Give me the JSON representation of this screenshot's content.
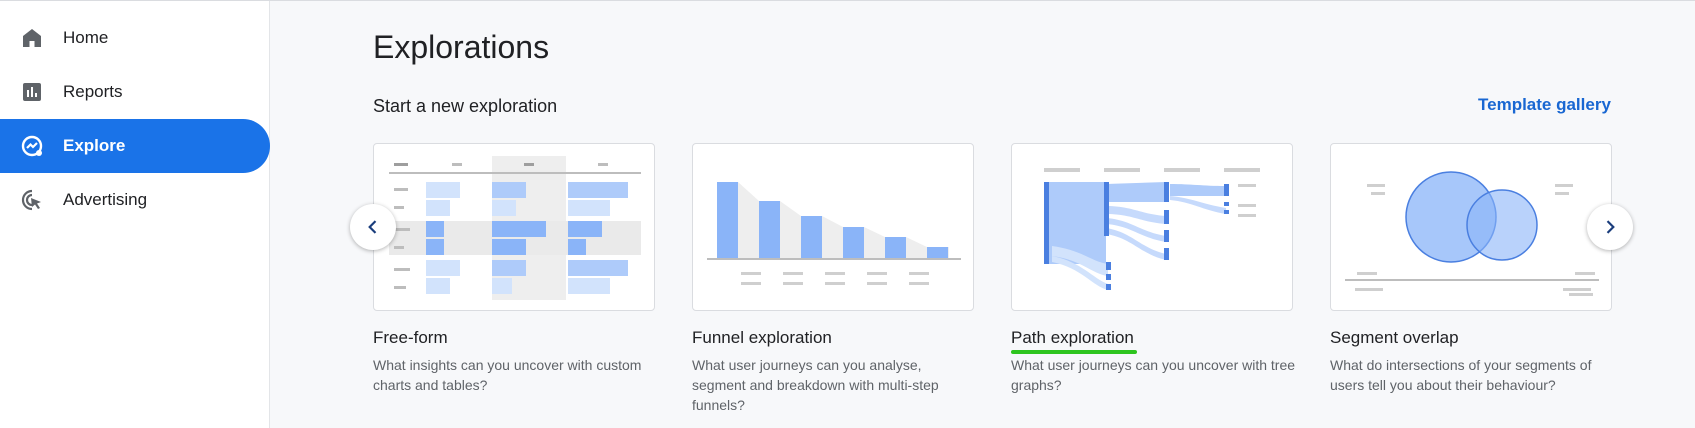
{
  "sidebar": {
    "items": [
      {
        "label": "Home",
        "icon": "home-icon"
      },
      {
        "label": "Reports",
        "icon": "bar-chart-icon"
      },
      {
        "label": "Explore",
        "icon": "explore-icon",
        "active": true
      },
      {
        "label": "Advertising",
        "icon": "cursor-click-icon"
      }
    ]
  },
  "main": {
    "title": "Explorations",
    "section_title": "Start a new exploration",
    "template_gallery": "Template gallery",
    "cards": [
      {
        "title": "Free-form",
        "description": "What insights can you uncover with custom charts and tables?"
      },
      {
        "title": "Funnel exploration",
        "description": "What user journeys can you analyse, segment and breakdown with multi-step funnels?"
      },
      {
        "title": "Path exploration",
        "description": "What user journeys can you uncover with tree graphs?"
      },
      {
        "title": "Segment overlap",
        "description": "What do intersections of your segments of users tell you about their behaviour?"
      }
    ]
  },
  "colors": {
    "accent": "#1a73e8",
    "link": "#1967d2",
    "highlight_underline": "#2ec51f",
    "bar_blue": "#8ab4f8"
  }
}
